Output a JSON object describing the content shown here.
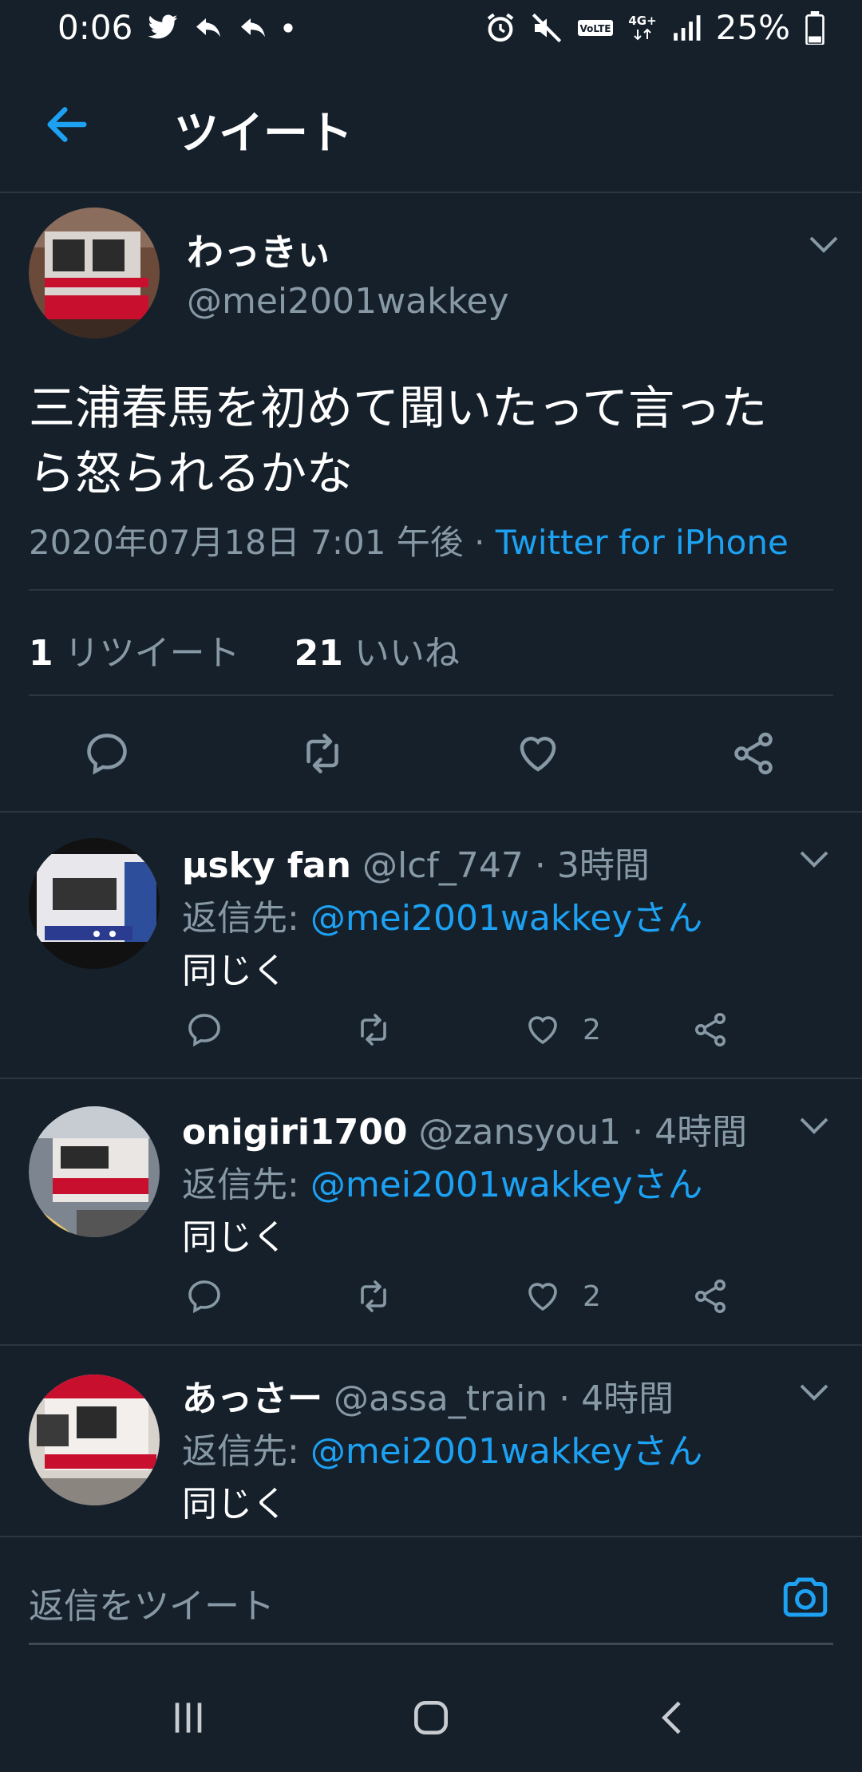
{
  "status_bar": {
    "time": "0:06",
    "left_icons": [
      "twitter-icon",
      "reply-notification-icon",
      "reply-notification-icon",
      "dot-icon"
    ],
    "right_icons": [
      "alarm-icon",
      "mute-icon",
      "volte-icon",
      "4g-icon",
      "signal-icon"
    ],
    "battery": "25%"
  },
  "app_bar": {
    "title": "ツイート"
  },
  "tweet": {
    "display_name": "わっきぃ",
    "handle": "@mei2001wakkey",
    "text_line1": "三浦春馬を初めて聞いたって言った",
    "text_line2": "ら怒られるかな",
    "timestamp": "2020年07月18日 7:01 午後 · ",
    "source": "Twitter for iPhone",
    "retweet_count": "1",
    "retweet_label": " リツイート",
    "like_count": "21",
    "like_label": " いいね"
  },
  "replies": [
    {
      "display_name": "µsky fan",
      "handle": " @lcf_747 · 3時間",
      "reply_prefix": "返信先: ",
      "reply_mention": "@mei2001wakkeyさん",
      "text": "同じく",
      "like_count": "2"
    },
    {
      "display_name": "onigiri1700",
      "handle": " @zansyou1 · 4時間",
      "reply_prefix": "返信先: ",
      "reply_mention": "@mei2001wakkeyさん",
      "text": "同じく",
      "like_count": "2"
    },
    {
      "display_name": "あっさー",
      "handle": " @assa_train · 4時間",
      "reply_prefix": "返信先: ",
      "reply_mention": "@mei2001wakkeyさん",
      "text": "同じく",
      "like_count": ""
    }
  ],
  "composer": {
    "placeholder": "返信をツイート"
  },
  "colors": {
    "background": "#15202b",
    "accent": "#1da1f2",
    "secondary_text": "#8899a6",
    "divider": "#2a3642"
  }
}
